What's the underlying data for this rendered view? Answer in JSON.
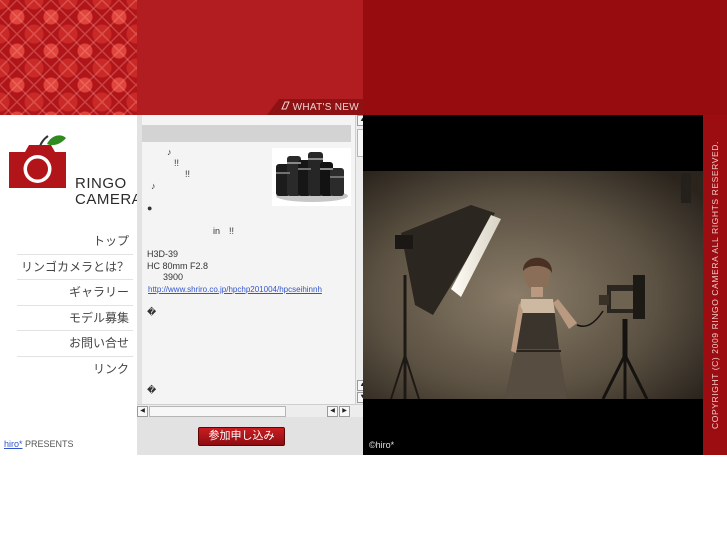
{
  "header": {
    "whats_new_label": "WHAT'S NEW"
  },
  "logo": {
    "line1": "RINGO",
    "line2": "CAMERA"
  },
  "nav": {
    "items": [
      "トップ",
      "リンゴカメラとは？",
      "ギャラリー",
      "モデル募集",
      "お問い合せ",
      "リンク"
    ]
  },
  "credit": {
    "link": "hiro*",
    "suffix": " PRESENTS"
  },
  "news": {
    "line_1": "♪",
    "line_2": "!!",
    "line_3": "!!",
    "line_4": "♪",
    "line_5": "●",
    "line_6": "in　!!",
    "line_7": "H3D-39",
    "line_8": "HC 80mm F2.8",
    "line_9": "3900",
    "link": "http://www.shriro.co.jp/hpchp201004/hpcseihinnh",
    "line_10": "�",
    "line_11": "�"
  },
  "join_button": "参加申し込み",
  "photo": {
    "credit": "©hiro*"
  },
  "copyright": "COPYRIGHT (C) 2009 RINGO CAMERA ALL RIGHTS RESERVED.",
  "colors": {
    "brand_red": "#b11d20",
    "dark_red": "#970c0f",
    "leaf_green": "#2f8a1f"
  },
  "icons": [
    "whats-new-icon",
    "logo-camera-icon",
    "scroll-up-icon",
    "scroll-down-icon",
    "scroll-left-icon",
    "scroll-right-icon"
  ]
}
